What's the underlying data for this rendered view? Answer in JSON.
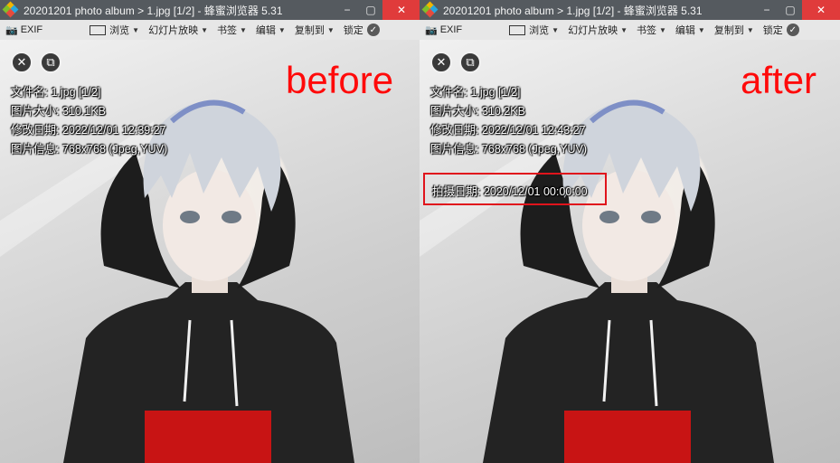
{
  "app": {
    "title": "20201201 photo album > 1.jpg [1/2] - 蜂蜜浏览器 5.31",
    "logo_colors": [
      "#f0b400",
      "#26a7e0",
      "#7fbf2a",
      "#e64b3c"
    ],
    "window_controls": {
      "minimize": "−",
      "restore": "▢",
      "close": "✕"
    },
    "close_color": "#e03b3b"
  },
  "toolbar": {
    "exif": "EXIF",
    "browse": "浏览",
    "slideshow": "幻灯片放映",
    "bookmark": "书签",
    "edit": "编辑",
    "copy_to": "复制到",
    "lock": "锁定"
  },
  "overlay_buttons": {
    "close": "✕",
    "copy": "⧉"
  },
  "before": {
    "label": "before",
    "file_name": "文件名: 1.jpg [1/2]",
    "file_size": "图片大小: 310.1KB",
    "modified": "修改日期: 2022/12/01 12:39:27",
    "image_info": "图片信息: 768x768 (Jpeg,YUV)"
  },
  "after": {
    "label": "after",
    "file_name": "文件名: 1.jpg [1/2]",
    "file_size": "图片大小: 310.2KB",
    "modified": "修改日期: 2022/12/01 12:43:27",
    "image_info": "图片信息: 768x768 (Jpeg,YUV)",
    "shot_date": "拍摄日期: 2020/12/01 00:00:00",
    "highlight_color": "#e0141c"
  },
  "label_color": "#ff0a0a"
}
